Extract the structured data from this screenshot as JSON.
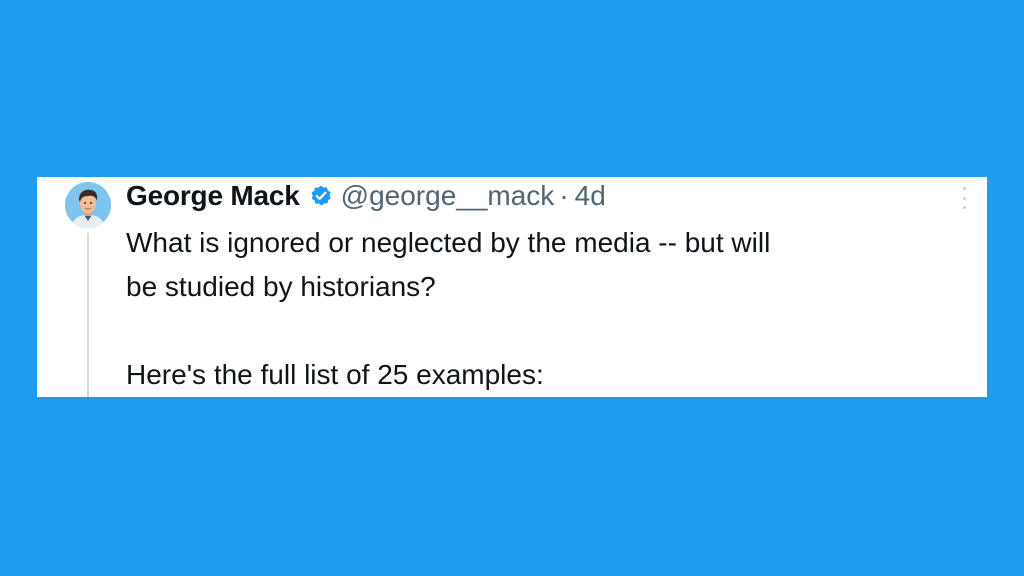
{
  "tweet": {
    "author_name": "George Mack",
    "handle": "@george__mack",
    "separator": "·",
    "time_ago": "4d",
    "verified": true,
    "verified_color": "#1d9bf0",
    "text_line_1": "What is ignored or neglected by the media -- but will",
    "text_line_2": "be studied by historians?",
    "text_line_3": "Here's the full list of 25 examples:"
  },
  "icons": {
    "avatar": "avatar-illustration",
    "verified": "verified-badge-icon",
    "more": "more-options-icon"
  },
  "colors": {
    "background": "#1f9bef",
    "card": "#ffffff",
    "text": "#0f1419",
    "secondary_text": "#536471"
  }
}
